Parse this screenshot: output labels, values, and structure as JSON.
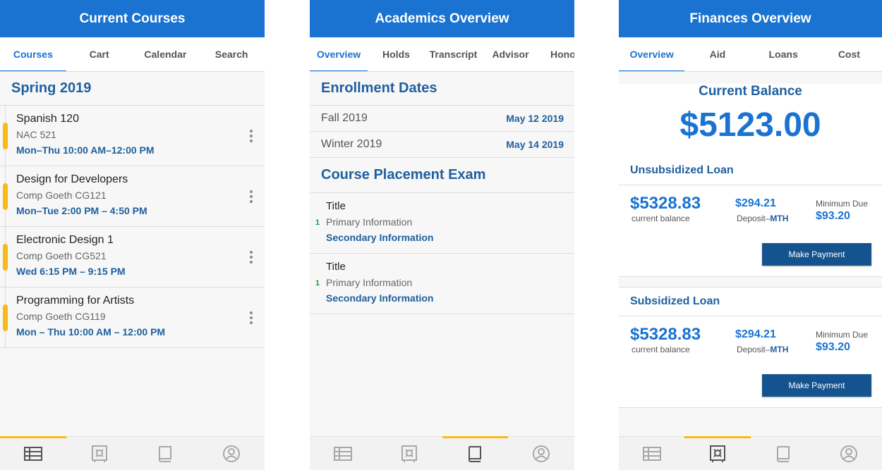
{
  "courses_screen": {
    "title": "Current Courses",
    "tabs": [
      "Courses",
      "Cart",
      "Calendar",
      "Search"
    ],
    "section": "Spring 2019",
    "courses": [
      {
        "name": "Spanish 120",
        "room": "NAC 521",
        "time": "Mon–Thu 10:00 AM–12:00 PM"
      },
      {
        "name": "Design for Developers",
        "room": "Comp Goeth CG121",
        "time": "Mon–Tue 2:00 PM – 4:50 PM"
      },
      {
        "name": "Electronic Design 1",
        "room": "Comp Goeth  CG521",
        "time": "Wed 6:15 PM – 9:15 PM"
      },
      {
        "name": "Programming for Artists",
        "room": "Comp Goeth CG119",
        "time": "Mon – Thu 10:00 AM – 12:00 PM"
      }
    ]
  },
  "academics_screen": {
    "title": "Academics Overview",
    "tabs": [
      "Overview",
      "Holds",
      "Transcript",
      "Advisor",
      "Honors"
    ],
    "enrollment_title": "Enrollment Dates",
    "enrollment": [
      {
        "term": "Fall 2019",
        "date": "May 12 2019"
      },
      {
        "term": "Winter 2019",
        "date": "May 14 2019"
      }
    ],
    "exam_title": "Course Placement Exam",
    "exams": [
      {
        "num": "1",
        "title": "Title",
        "primary": "Primary Information",
        "secondary": "Secondary Information"
      },
      {
        "num": "1",
        "title": "Title",
        "primary": "Primary Information",
        "secondary": "Secondary Information"
      }
    ]
  },
  "finances_screen": {
    "title": "Finances Overview",
    "tabs": [
      "Overview",
      "Aid",
      "Loans",
      "Cost"
    ],
    "balance_label": "Current Balance",
    "balance_amount": "$5123.00",
    "loans": [
      {
        "title": "Unsubsidized Loan",
        "balance": "$5328.83",
        "balance_sub": "current balance",
        "deposit": "$294.21",
        "deposit_label": "Deposit–",
        "deposit_unit": "MTH",
        "min_label": "Minimum Due",
        "min_value": "$93.20",
        "button": "Make Payment"
      },
      {
        "title": "Subsidized Loan",
        "balance": "$5328.83",
        "balance_sub": "current balance",
        "deposit": "$294.21",
        "deposit_label": "Deposit–",
        "deposit_unit": "MTH",
        "min_label": "Minimum Due",
        "min_value": "$93.20",
        "button": "Make Payment"
      }
    ]
  },
  "bottom_nav": {
    "icons": [
      "list-icon",
      "safe-icon",
      "book-icon",
      "profile-icon"
    ],
    "active_by_screen": {
      "courses": 0,
      "academics": 2,
      "finances": 1
    },
    "active_color": "#f9b917",
    "active_icon_color": "#555555",
    "inactive_icon_color": "#a8a8a8"
  },
  "colors": {
    "primary": "#1a73d1",
    "dark_blue": "#1f5fa0",
    "button": "#15538f",
    "accent": "#f9b917"
  }
}
